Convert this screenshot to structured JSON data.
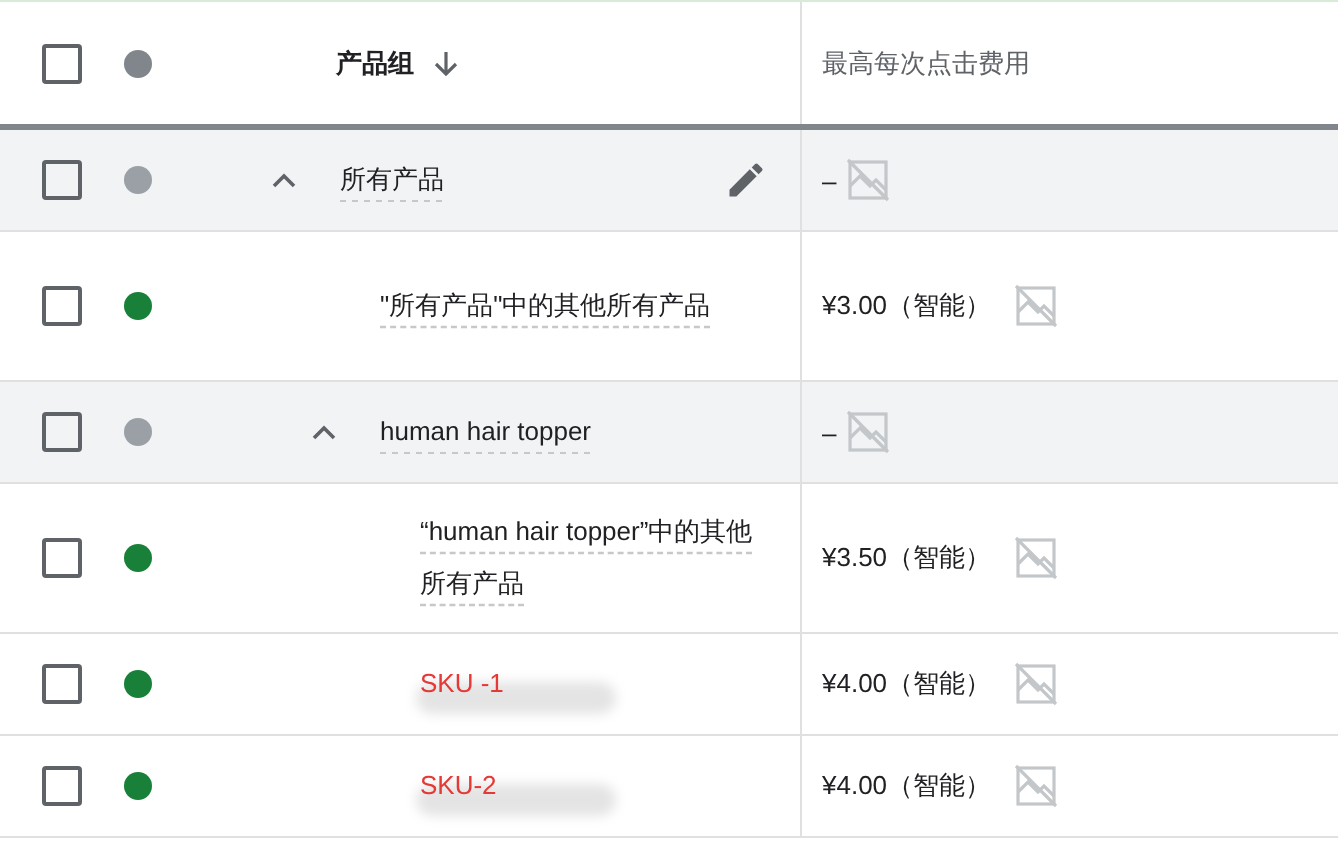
{
  "header": {
    "checked": false,
    "product_group": "产品组",
    "max_cpc": "最高每次点击费用"
  },
  "rows": [
    {
      "kind": "group",
      "name": "所有产品",
      "checked": false,
      "color": "#9aa0a6",
      "expanded": true,
      "editable": true,
      "bid": "–",
      "children": [
        {
          "kind": "leaf",
          "name": "\"所有产品\"中的其他所有产品",
          "checked": false,
          "color": "#188038",
          "editable": false,
          "bid": "¥3.00（智能）"
        },
        {
          "kind": "group",
          "name": "human hair topper",
          "checked": false,
          "color": "#9aa0a6",
          "expanded": true,
          "editable": false,
          "bid": "–",
          "children": [
            {
              "kind": "leaf",
              "name": "“human hair topper”中的其他所有产品",
              "checked": false,
              "color": "#188038",
              "editable": false,
              "bid": "¥3.50（智能）"
            },
            {
              "kind": "sku",
              "name": "SKU -1",
              "checked": false,
              "color": "#188038",
              "editable": false,
              "bid": "¥4.00（智能）"
            },
            {
              "kind": "sku",
              "name": "SKU-2",
              "checked": false,
              "color": "#188038",
              "editable": false,
              "bid": "¥4.00（智能）"
            }
          ]
        }
      ]
    }
  ]
}
